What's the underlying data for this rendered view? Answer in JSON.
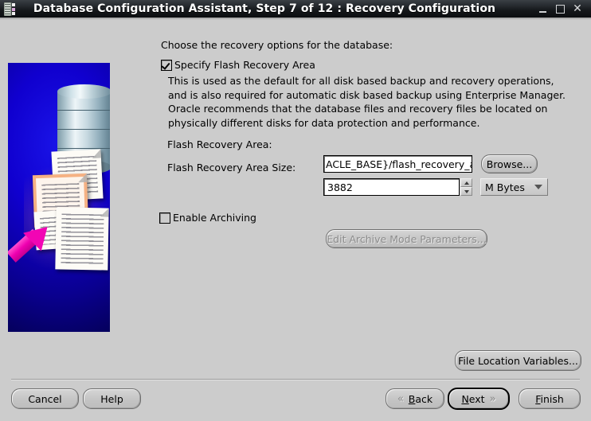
{
  "window": {
    "title": "Database Configuration Assistant, Step 7 of 12 : Recovery Configuration",
    "app_icon": "database-app-icon",
    "controls": {
      "minimize": "minimize-icon",
      "maximize": "maximize-icon",
      "close": "close-icon"
    }
  },
  "main": {
    "intro": "Choose the recovery options for the database:",
    "specify_flash_recovery_area": {
      "label": "Specify Flash Recovery Area",
      "checked": true
    },
    "description": "This is used as the default for all disk based backup and recovery operations, and is also required for automatic disk based backup using Enterprise Manager. Oracle recommends that the database files and recovery files be located on physically different disks for data protection and performance.",
    "flash_recovery_area": {
      "label": "Flash Recovery Area:",
      "value_before_caret": "ACLE_B",
      "value_after_caret": "ASE}/flash_recovery_area",
      "browse_label": "Browse..."
    },
    "flash_recovery_area_size": {
      "label": "Flash Recovery Area Size:",
      "value": "3882",
      "unit": "M Bytes",
      "spinner_up": "spinner-up-icon",
      "spinner_down": "spinner-down-icon",
      "combo_arrow": "chevron-down-icon"
    },
    "enable_archiving": {
      "label": "Enable Archiving",
      "checked": false
    },
    "edit_archive_mode": {
      "label": "Edit Archive Mode Parameters...",
      "enabled": false
    },
    "file_location_variables": "File Location Variables..."
  },
  "footer": {
    "cancel": "Cancel",
    "help": "Help",
    "back": "Back",
    "back_mnemonic": "B",
    "next": "Next",
    "next_mnemonic": "N",
    "finish": "Finish",
    "finish_mnemonic": "F",
    "back_chevron": "double-chevron-left-icon",
    "next_chevron": "double-chevron-right-icon"
  },
  "colors": {
    "window_background": "#cccccc",
    "titlebar": "#14171a",
    "art_blue": "#1000cf",
    "arrow_magenta": "#f205b4",
    "field_white": "#ffffff",
    "disabled_text": "#8d8d8d"
  }
}
